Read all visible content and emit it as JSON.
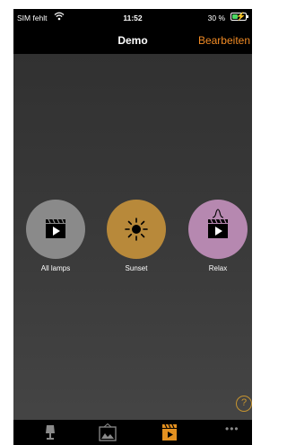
{
  "status_bar": {
    "carrier": "SIM fehlt",
    "time": "11:52",
    "battery": "30 %"
  },
  "nav": {
    "title": "Demo",
    "edit_label": "Bearbeiten"
  },
  "scenes": [
    {
      "label": "All lamps",
      "color": "#8a8a8a",
      "icon": "clapperboard-icon"
    },
    {
      "label": "Sunset",
      "color": "#b8893a",
      "icon": "sun-icon"
    },
    {
      "label": "Relax",
      "color": "#b688b0",
      "icon": "clapperboard-relax-icon"
    }
  ],
  "help": {
    "label": "?"
  },
  "tab_bar": {
    "tabs": [
      {
        "icon": "lamp-icon",
        "active": false
      },
      {
        "icon": "picture-icon",
        "active": false
      },
      {
        "icon": "scenes-icon",
        "active": true
      },
      {
        "icon": "more-icon",
        "label": "•••",
        "active": false
      }
    ]
  },
  "colors": {
    "accent": "#f08a24",
    "active_tab": "#e39020",
    "inactive_tab": "#8a8a8a"
  }
}
